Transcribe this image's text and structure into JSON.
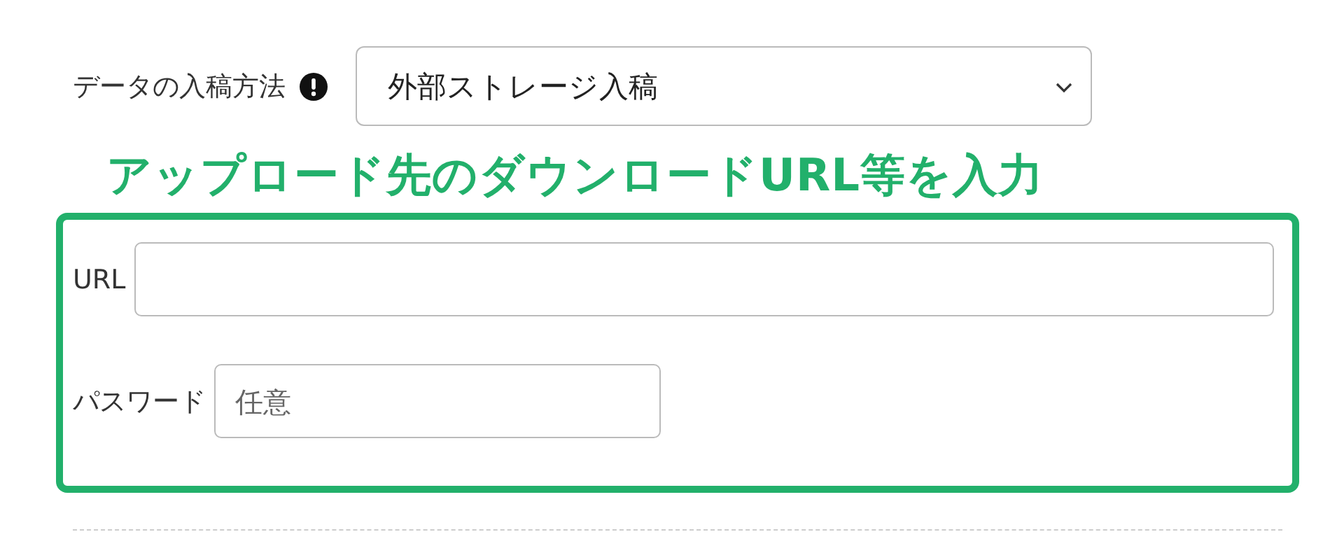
{
  "method_field": {
    "label": "データの入稿方法",
    "value": "外部ストレージ入稿"
  },
  "annotation": {
    "text": "アップロード先のダウンロードURL等を入力"
  },
  "fields": [
    {
      "label": "URL",
      "kind": "wide"
    },
    {
      "label": "パスワード",
      "placeholder": "任意",
      "kind": "short"
    }
  ]
}
